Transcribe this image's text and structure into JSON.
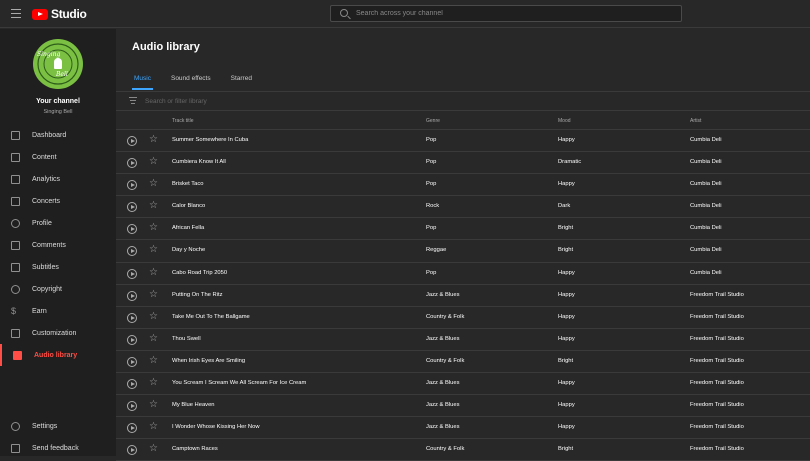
{
  "header": {
    "app_name": "Studio",
    "search_placeholder": "Search across your channel"
  },
  "channel": {
    "title": "Your channel",
    "name": "Singing Bell",
    "avatar_text_top": "Singing",
    "avatar_text_bottom": "Bell"
  },
  "sidebar": {
    "items": [
      {
        "label": "Dashboard",
        "icon": "dashboard-icon"
      },
      {
        "label": "Content",
        "icon": "content-icon"
      },
      {
        "label": "Analytics",
        "icon": "analytics-icon"
      },
      {
        "label": "Concerts",
        "icon": "concerts-icon"
      },
      {
        "label": "Profile",
        "icon": "profile-icon"
      },
      {
        "label": "Comments",
        "icon": "comments-icon"
      },
      {
        "label": "Subtitles",
        "icon": "subtitles-icon"
      },
      {
        "label": "Copyright",
        "icon": "copyright-icon"
      },
      {
        "label": "Earn",
        "icon": "earn-icon"
      },
      {
        "label": "Customization",
        "icon": "customization-icon"
      },
      {
        "label": "Audio library",
        "icon": "audio-library-icon",
        "active": true
      }
    ],
    "bottom": [
      {
        "label": "Settings",
        "icon": "settings-icon"
      },
      {
        "label": "Send feedback",
        "icon": "feedback-icon"
      }
    ]
  },
  "main": {
    "title": "Audio library",
    "tabs": [
      "Music",
      "Sound effects",
      "Starred"
    ],
    "active_tab": 0,
    "filter_placeholder": "Search or filter library",
    "columns": {
      "title": "Track title",
      "genre": "Genre",
      "mood": "Mood",
      "artist": "Artist"
    },
    "tracks": [
      {
        "title": "Summer Somewhere In Cuba",
        "genre": "Pop",
        "mood": "Happy",
        "artist": "Cumbia Deli"
      },
      {
        "title": "Cumbiera Know It All",
        "genre": "Pop",
        "mood": "Dramatic",
        "artist": "Cumbia Deli"
      },
      {
        "title": "Brisket Taco",
        "genre": "Pop",
        "mood": "Happy",
        "artist": "Cumbia Deli"
      },
      {
        "title": "Calor Blanco",
        "genre": "Rock",
        "mood": "Dark",
        "artist": "Cumbia Deli"
      },
      {
        "title": "African Fella",
        "genre": "Pop",
        "mood": "Bright",
        "artist": "Cumbia Deli"
      },
      {
        "title": "Day y Noche",
        "genre": "Reggae",
        "mood": "Bright",
        "artist": "Cumbia Deli"
      },
      {
        "title": "Cabo Road Trip 2050",
        "genre": "Pop",
        "mood": "Happy",
        "artist": "Cumbia Deli"
      },
      {
        "title": "Putting On The Ritz",
        "genre": "Jazz & Blues",
        "mood": "Happy",
        "artist": "Freedom Trail Studio"
      },
      {
        "title": "Take Me Out To The Ballgame",
        "genre": "Country & Folk",
        "mood": "Happy",
        "artist": "Freedom Trail Studio"
      },
      {
        "title": "Thou Swell",
        "genre": "Jazz & Blues",
        "mood": "Happy",
        "artist": "Freedom Trail Studio"
      },
      {
        "title": "When Irish Eyes Are Smiling",
        "genre": "Country & Folk",
        "mood": "Bright",
        "artist": "Freedom Trail Studio"
      },
      {
        "title": "You Scream I Scream We All Scream For Ice Cream",
        "genre": "Jazz & Blues",
        "mood": "Happy",
        "artist": "Freedom Trail Studio"
      },
      {
        "title": "My Blue Heaven",
        "genre": "Jazz & Blues",
        "mood": "Happy",
        "artist": "Freedom Trail Studio"
      },
      {
        "title": "I Wonder Whose Kissing Her Now",
        "genre": "Jazz & Blues",
        "mood": "Happy",
        "artist": "Freedom Trail Studio"
      },
      {
        "title": "Camptown Races",
        "genre": "Country & Folk",
        "mood": "Bright",
        "artist": "Freedom Trail Studio"
      }
    ]
  },
  "colors": {
    "accent": "#3ea6ff",
    "active_nav": "#ff4e45",
    "brand": "#ff0000",
    "avatar_bg": "#7bc043"
  }
}
